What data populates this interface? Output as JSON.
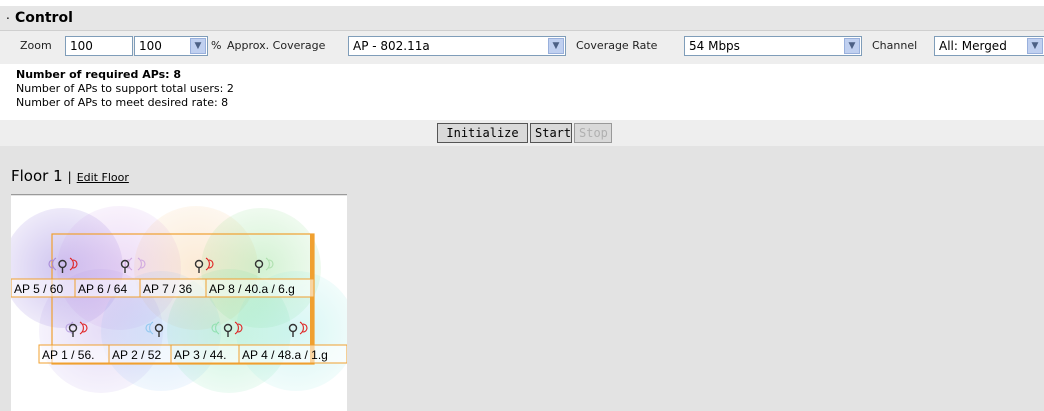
{
  "header": {
    "title": "Control"
  },
  "toolbar": {
    "zoom_label": "Zoom",
    "zoom_value": "100",
    "zoom_select": "100",
    "zoom_unit": "%",
    "coverage_label": "Approx. Coverage",
    "coverage_value": "AP - 802.11a",
    "rate_label": "Coverage Rate",
    "rate_value": "54 Mbps",
    "channel_label": "Channel",
    "channel_value": "All: Merged"
  },
  "stats": {
    "required": "Number of required APs: 8",
    "users": "Number of APs to support total users: 2",
    "rate": "Number of APs to meet desired rate: 8"
  },
  "buttons": {
    "initialize": "Initialize",
    "start": "Start",
    "stop": "Stop"
  },
  "floor": {
    "title": "Floor 1",
    "separator": "|",
    "edit_link": "Edit Floor"
  },
  "aps": [
    {
      "label": "AP 5 / 60",
      "color": "#8a6cc8"
    },
    {
      "label": "AP 6 / 64",
      "color": "#c09bd8"
    },
    {
      "label": "AP 7 / 36",
      "color": "#f0c27a"
    },
    {
      "label": "AP 8 / 40.a / 6.g",
      "color": "#86d08a"
    },
    {
      "label": "AP 1 / 56.",
      "color": "#b59be0"
    },
    {
      "label": "AP 2 / 52",
      "color": "#8fc6f0"
    },
    {
      "label": "AP 3 / 44.",
      "color": "#7fe0a0"
    },
    {
      "label": "AP 4 / 48.a / 1.g",
      "color": "#9fe8e0"
    }
  ],
  "colors": {
    "accent": "#f0a030",
    "signal_red": "#e02020",
    "signal_gray": "#888888"
  }
}
